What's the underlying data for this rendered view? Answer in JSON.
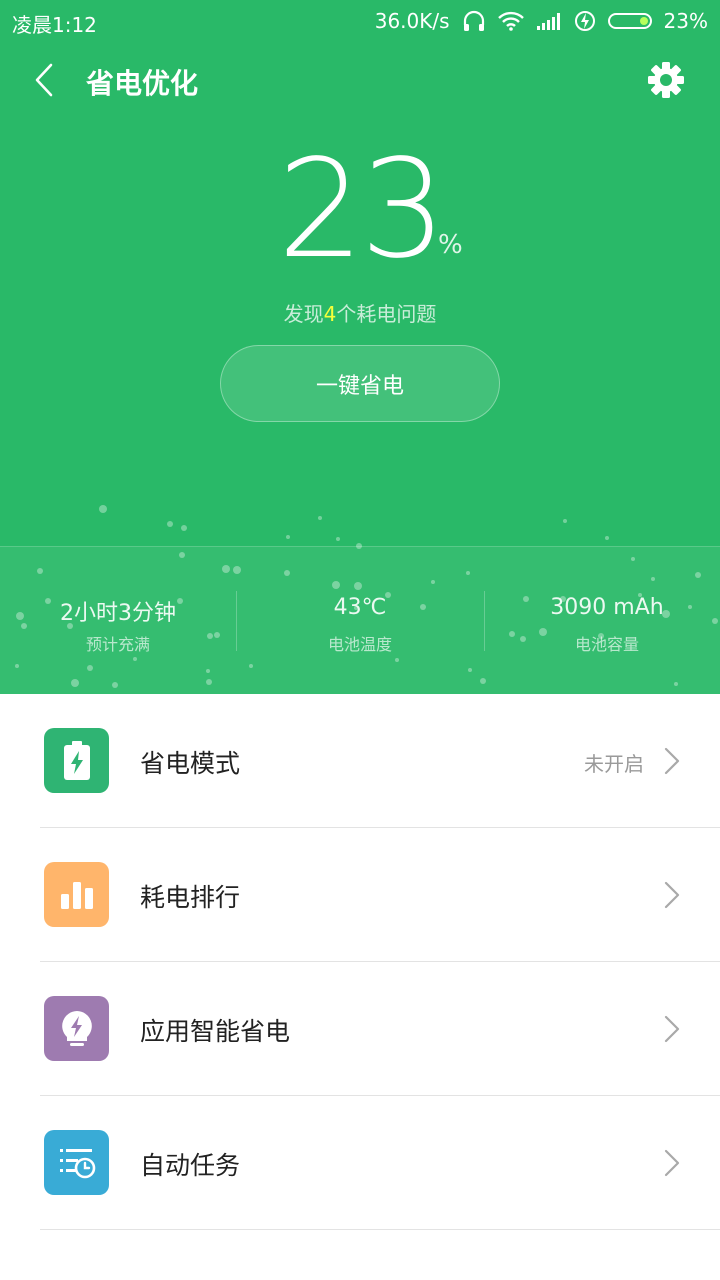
{
  "status_bar": {
    "time": "凌晨1:12",
    "net_speed": "36.0K/s",
    "battery_text": "23%",
    "battery_level": 0.23
  },
  "header": {
    "title": "省电优化"
  },
  "summary": {
    "percent": "23",
    "percent_sign": "%",
    "issue_prefix": "发现",
    "issue_count": "4",
    "issue_suffix": "个耗电问题",
    "button_label": "一键省电"
  },
  "stats": [
    {
      "value": "2小时3分钟",
      "label": "预计充满"
    },
    {
      "value": "43℃",
      "label": "电池温度"
    },
    {
      "value": "3090 mAh",
      "label": "电池容量"
    }
  ],
  "list": [
    {
      "label": "省电模式",
      "status": "未开启",
      "icon": "battery-bolt-icon",
      "color": "#2fb473"
    },
    {
      "label": "耗电排行",
      "status": "",
      "icon": "bar-chart-icon",
      "color": "#ffb56b"
    },
    {
      "label": "应用智能省电",
      "status": "",
      "icon": "bulb-bolt-icon",
      "color": "#9e7bb0"
    },
    {
      "label": "自动任务",
      "status": "",
      "icon": "task-clock-icon",
      "color": "#39abd6"
    }
  ],
  "colors": {
    "hero_bg": "#29b968",
    "highlight": "#f6ff3a"
  }
}
